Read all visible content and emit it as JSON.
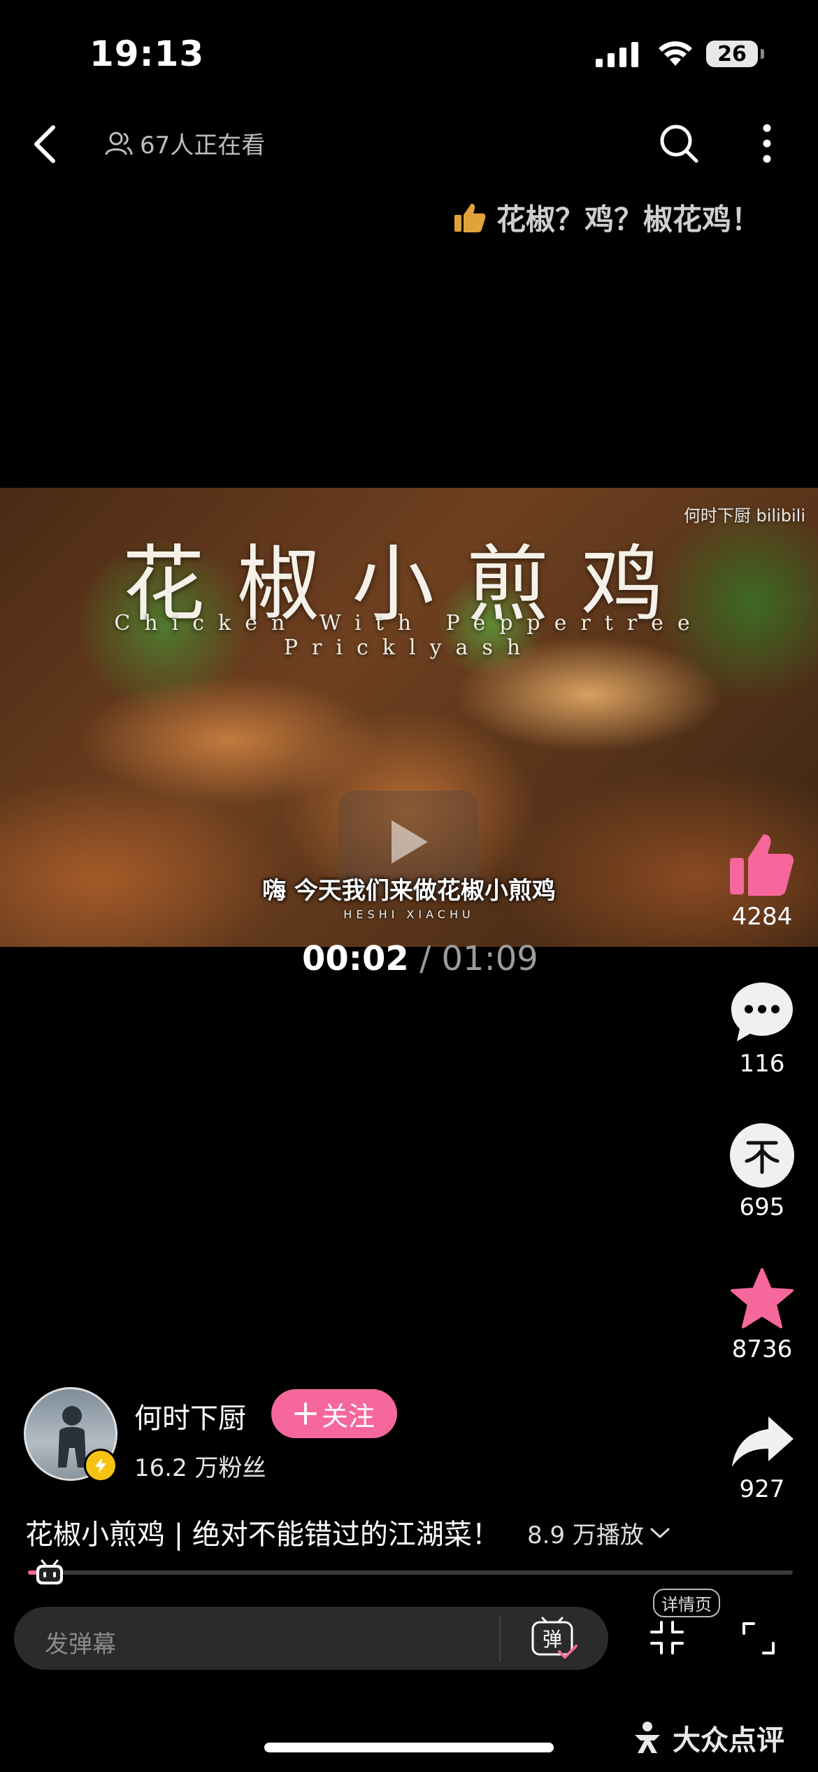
{
  "status_bar": {
    "time": "19:13",
    "battery": "26"
  },
  "top_bar": {
    "viewers_text": "67人正在看"
  },
  "recommend": {
    "text": "花椒？鸡？椒花鸡！"
  },
  "video": {
    "title_overlay": "花椒小煎鸡",
    "subtitle_overlay": "Chicken With Peppertree Pricklyash",
    "watermark": "何时下厨 bilibili",
    "caption": "嗨 今天我们来做花椒小煎鸡",
    "caption_sub": "HESHI XIACHU",
    "current_time": "00:02",
    "separator": "/",
    "total_time": "01:09"
  },
  "actions": {
    "like_count": "4284",
    "comment_count": "116",
    "coin_count": "695",
    "favorite_count": "8736",
    "share_count": "927"
  },
  "author": {
    "name": "何时下厨",
    "follow_label": "关注",
    "fans": "16.2 万粉丝"
  },
  "description": {
    "title": "花椒小煎鸡 | 绝对不能错过的江湖菜！",
    "play_count": "8.9 万播放"
  },
  "progress": {
    "fraction": 0.02
  },
  "bottom_bar": {
    "danmaku_placeholder": "发弹幕",
    "detail_label": "详情页"
  },
  "brand": {
    "name": "大众点评"
  },
  "colors": {
    "accent": "#f6679b",
    "recommend_icon": "#e0a33a",
    "verified": "#f7c313"
  }
}
